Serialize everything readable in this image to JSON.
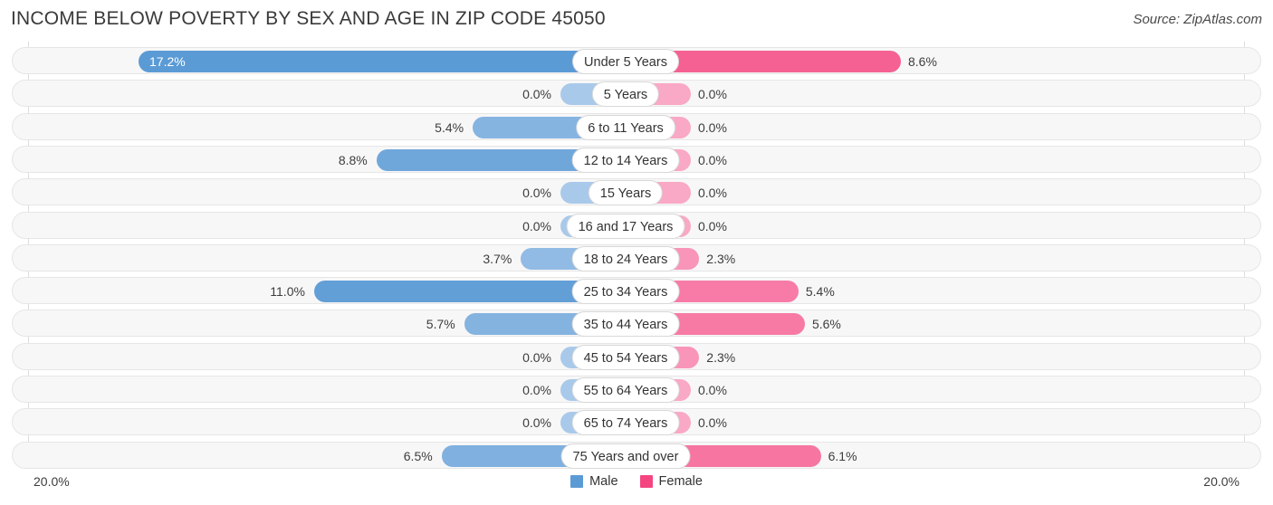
{
  "header": {
    "title": "INCOME BELOW POVERTY BY SEX AND AGE IN ZIP CODE 45050",
    "source": "Source: ZipAtlas.com"
  },
  "axis": {
    "left_label": "20.0%",
    "right_label": "20.0%"
  },
  "legend": {
    "items": [
      {
        "label": "Male",
        "color": "#5b9bd5"
      },
      {
        "label": "Female",
        "color": "#f4457f"
      }
    ]
  },
  "chart_data": {
    "type": "bar",
    "subtype": "diverging-bidirectional",
    "title": "INCOME BELOW POVERTY BY SEX AND AGE IN ZIP CODE 45050",
    "xlabel": "",
    "ylabel": "",
    "xlim": [
      -20.0,
      20.0
    ],
    "axis_left_label": "20.0%",
    "axis_right_label": "20.0%",
    "grid": false,
    "legend_position": "bottom-center",
    "categories": [
      "Under 5 Years",
      "5 Years",
      "6 to 11 Years",
      "12 to 14 Years",
      "15 Years",
      "16 and 17 Years",
      "18 to 24 Years",
      "25 to 34 Years",
      "35 to 44 Years",
      "45 to 54 Years",
      "55 to 64 Years",
      "65 to 74 Years",
      "75 Years and over"
    ],
    "series": [
      {
        "name": "Male",
        "color": "#5b9bd5",
        "direction": "left",
        "values": [
          17.2,
          0.0,
          5.4,
          8.8,
          0.0,
          0.0,
          3.7,
          11.0,
          5.7,
          0.0,
          0.0,
          0.0,
          6.5
        ],
        "labels": [
          "17.2%",
          "0.0%",
          "5.4%",
          "8.8%",
          "0.0%",
          "0.0%",
          "3.7%",
          "11.0%",
          "5.7%",
          "0.0%",
          "0.0%",
          "0.0%",
          "6.5%"
        ]
      },
      {
        "name": "Female",
        "color": "#f4457f",
        "direction": "right",
        "values": [
          8.6,
          0.0,
          0.0,
          0.0,
          0.0,
          0.0,
          2.3,
          5.4,
          5.6,
          2.3,
          0.0,
          0.0,
          6.1
        ],
        "labels": [
          "8.6%",
          "0.0%",
          "0.0%",
          "0.0%",
          "0.0%",
          "0.0%",
          "2.3%",
          "5.4%",
          "5.6%",
          "2.3%",
          "0.0%",
          "0.0%",
          "6.1%"
        ]
      }
    ]
  },
  "rows": [
    {
      "category": "Under 5 Years",
      "male": "17.2%",
      "female": "8.6%"
    },
    {
      "category": "5 Years",
      "male": "0.0%",
      "female": "0.0%"
    },
    {
      "category": "6 to 11 Years",
      "male": "5.4%",
      "female": "0.0%"
    },
    {
      "category": "12 to 14 Years",
      "male": "8.8%",
      "female": "0.0%"
    },
    {
      "category": "15 Years",
      "male": "0.0%",
      "female": "0.0%"
    },
    {
      "category": "16 and 17 Years",
      "male": "0.0%",
      "female": "0.0%"
    },
    {
      "category": "18 to 24 Years",
      "male": "3.7%",
      "female": "2.3%"
    },
    {
      "category": "25 to 34 Years",
      "male": "11.0%",
      "female": "5.4%"
    },
    {
      "category": "35 to 44 Years",
      "male": "5.7%",
      "female": "5.6%"
    },
    {
      "category": "45 to 54 Years",
      "male": "0.0%",
      "female": "2.3%"
    },
    {
      "category": "55 to 64 Years",
      "male": "0.0%",
      "female": "0.0%"
    },
    {
      "category": "65 to 74 Years",
      "male": "0.0%",
      "female": "0.0%"
    },
    {
      "category": "75 Years and over",
      "male": "6.5%",
      "female": "6.1%"
    }
  ]
}
